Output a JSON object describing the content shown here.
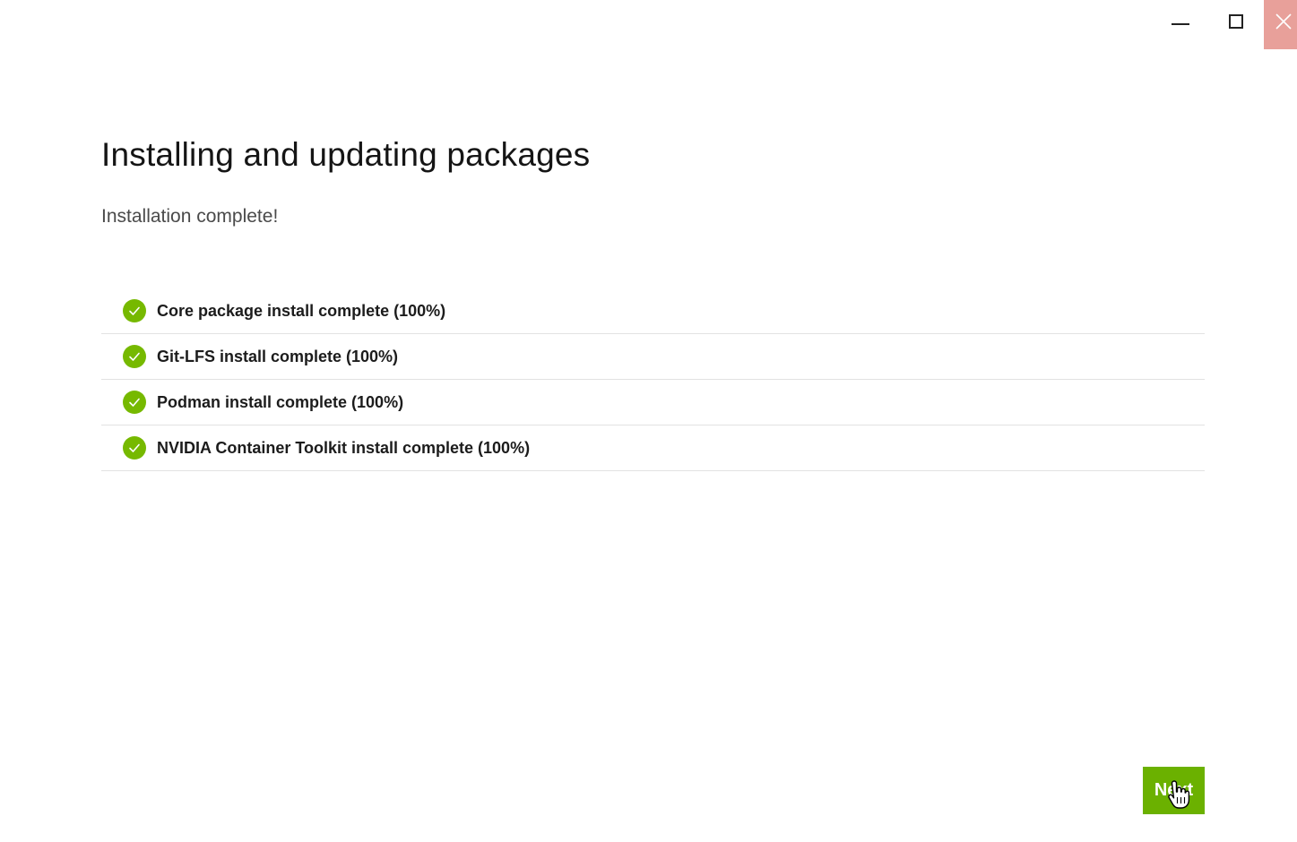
{
  "window": {
    "controls": {
      "minimize_icon": "minimize-icon",
      "maximize_icon": "maximize-icon",
      "close_icon": "close-icon"
    }
  },
  "main": {
    "title": "Installing and updating packages",
    "status": "Installation complete!",
    "tasks": [
      {
        "label": "Core package install complete (100%)",
        "progress": 100,
        "icon": "check-circle-icon"
      },
      {
        "label": "Git-LFS install complete (100%)",
        "progress": 100,
        "icon": "check-circle-icon"
      },
      {
        "label": "Podman install complete (100%)",
        "progress": 100,
        "icon": "check-circle-icon"
      },
      {
        "label": "NVIDIA Container Toolkit install complete (100%)",
        "progress": 100,
        "icon": "check-circle-icon"
      }
    ]
  },
  "footer": {
    "next_label": "Next"
  },
  "colors": {
    "accent": "#76b900",
    "button": "#6bb100",
    "close_hover": "#e8a09a"
  }
}
